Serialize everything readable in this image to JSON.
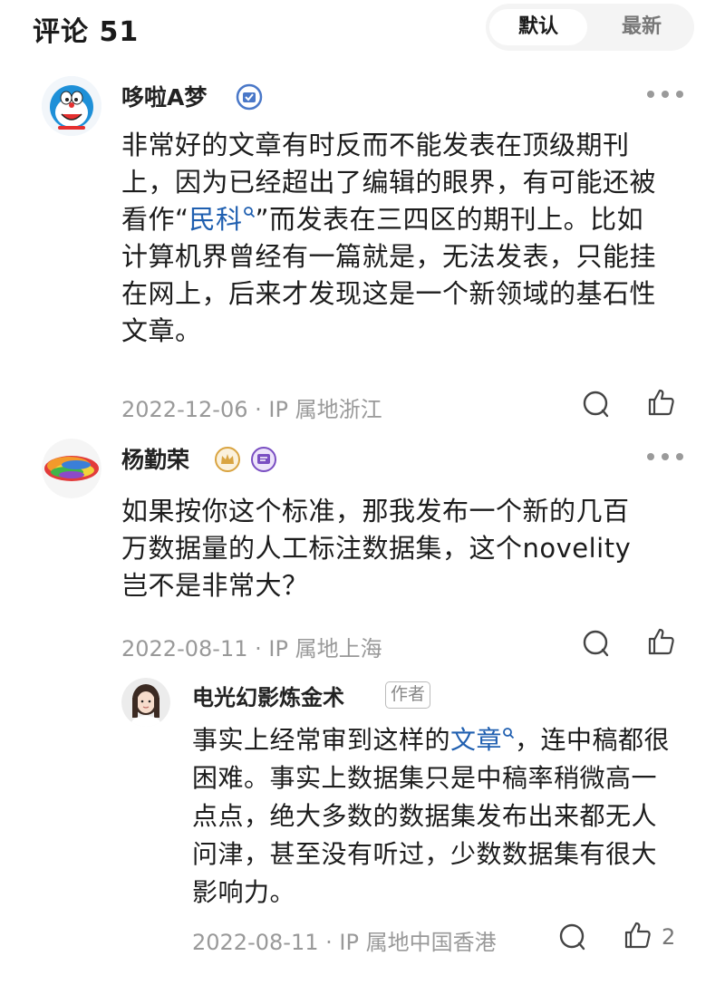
{
  "header": {
    "title": "评论 51",
    "sort_default": "默认",
    "sort_latest": "最新"
  },
  "comments": [
    {
      "username": "哆啦A梦",
      "content_parts": [
        "非常好的文章有时反而不能发表在顶级期刊上，因为已经超出了编辑的眼界，有可能还被看作“",
        "民科",
        "”而发表在三四区的期刊上。比如计算机界曾经有一篇就是，无法发表，只能挂在网上，后来才发现这是一个新领域的基石性文章。"
      ],
      "date": "2022-12-06",
      "location": "IP 属地浙江"
    },
    {
      "username": "杨勤荣",
      "content": "如果按你这个标准，那我发布一个新的几百万数据量的人工标注数据集，这个novelity岂不是非常大？",
      "date": "2022-08-11",
      "location": "IP 属地上海"
    }
  ],
  "reply": {
    "username": "电光幻影炼金术",
    "author_tag": "作者",
    "content_parts": [
      "事实上经常审到这样的",
      "文章",
      "，连中稿都很困难。事实上数据集只是中稿率稍微高一点点，绝大多数的数据集发布出来都无人问津，甚至没有听过，少数数据集有很大影响力。"
    ],
    "date": "2022-08-11",
    "location": "IP 属地中国香港",
    "like_count": "2"
  },
  "separator": "·",
  "colors": {
    "link": "#1f5fb0",
    "meta": "#999999",
    "verified_badge": "#4a78c8",
    "gold_badge": "#d9a441",
    "purple_badge": "#7a4fc2"
  }
}
